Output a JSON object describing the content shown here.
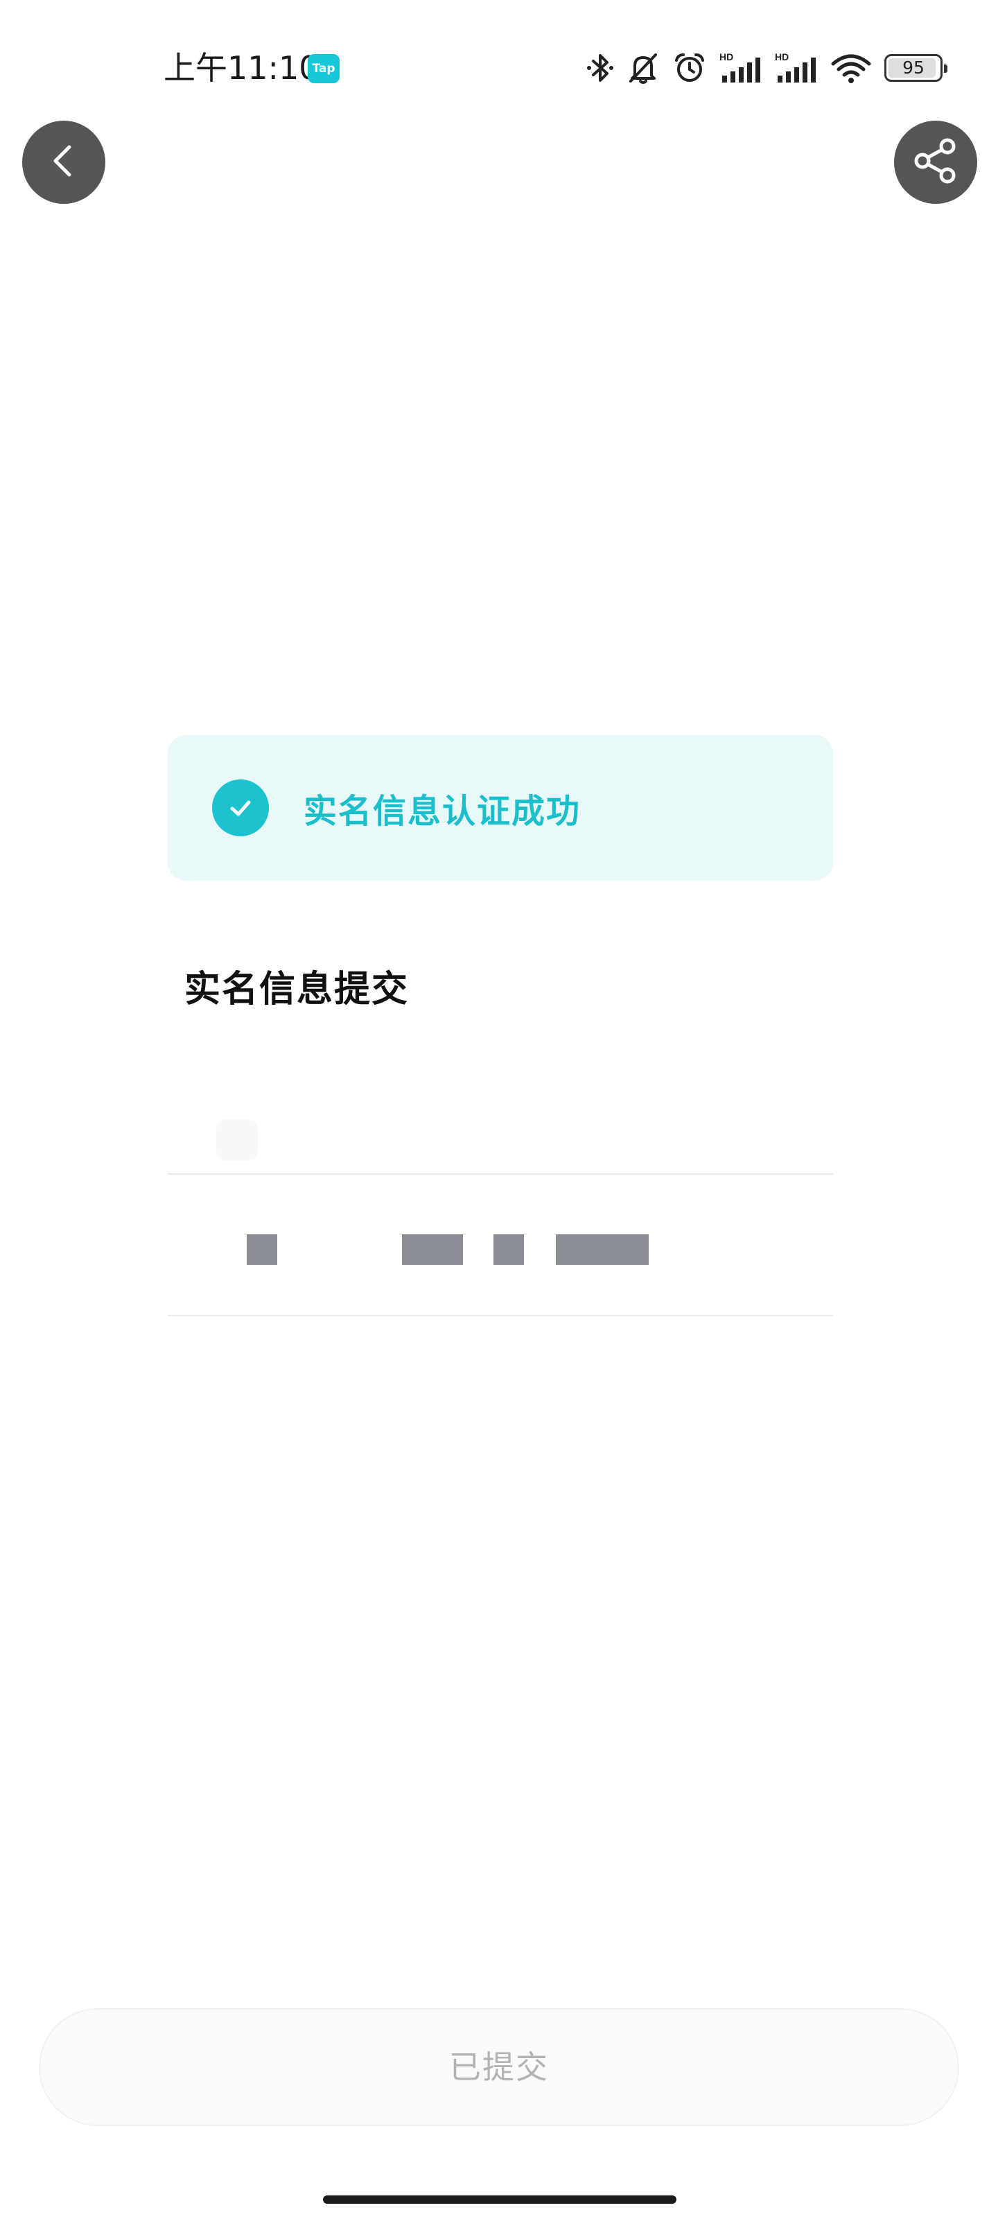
{
  "status_bar": {
    "time": "上午11:10",
    "app_badge": "Tap",
    "battery_level": 95,
    "icons": [
      "bluetooth-icon",
      "mute-icon",
      "alarm-icon",
      "signal-hd-1-icon",
      "signal-hd-2-icon",
      "wifi-icon",
      "battery-icon"
    ],
    "hd_label": "HD"
  },
  "nav": {
    "back_icon": "chevron-left-icon",
    "share_icon": "share-icon"
  },
  "banner": {
    "icon": "check-circle-icon",
    "message": "实名信息认证成功",
    "accent_color": "#1bbfcc"
  },
  "section": {
    "title": "实名信息提交"
  },
  "fields": [
    {
      "value_redacted": true
    },
    {
      "value_redacted": true
    }
  ],
  "footer": {
    "submit_label": "已提交"
  }
}
